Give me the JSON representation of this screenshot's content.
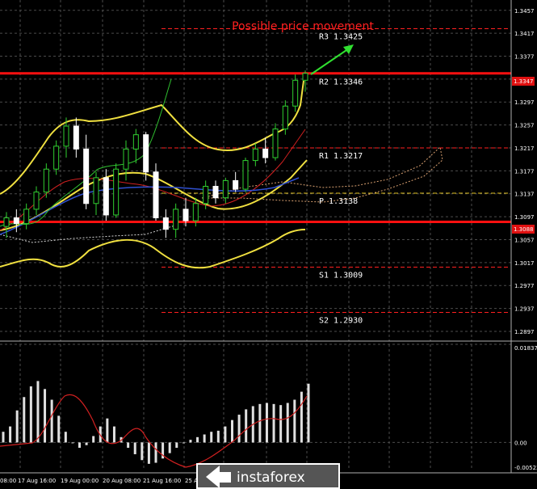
{
  "chart_data": {
    "type": "candlestick",
    "title": "Possible price movement",
    "price_axis": {
      "ylim": [
        1.288,
        1.3475
      ],
      "ticks": [
        "1.3457",
        "1.3417",
        "1.3377",
        "1.3337",
        "1.3297",
        "1.3257",
        "1.3217",
        "1.3177",
        "1.3137",
        "1.3097",
        "1.3057",
        "1.3017",
        "1.2977",
        "1.2937",
        "1.2897"
      ],
      "current_price": "1.3347",
      "marked_price": "1.3088"
    },
    "time_axis": {
      "labels": [
        "08:00",
        "17 Aug 16:00",
        "19 Aug 00:00",
        "20 Aug 08:00",
        "21 Aug 16:00",
        "25 A"
      ]
    },
    "levels": [
      {
        "name": "R3",
        "price": 1.3425,
        "label": "R3 1.3425",
        "color": "#ff2020"
      },
      {
        "name": "R2",
        "price": 1.3346,
        "label": "R2 1.3346",
        "color": "#ff2020"
      },
      {
        "name": "R1",
        "price": 1.3217,
        "label": "R1 1.3217",
        "color": "#ff2020"
      },
      {
        "name": "P",
        "price": 1.3138,
        "label": "P 1.3138",
        "color": "#e0c020"
      },
      {
        "name": "S1",
        "price": 1.3009,
        "label": "S1 1.3009",
        "color": "#ff2020"
      },
      {
        "name": "S2",
        "price": 1.293,
        "label": "S2 1.2930",
        "color": "#ff2020"
      }
    ],
    "support_resistance_lines": [
      1.3347,
      1.3088
    ],
    "candles": [
      [
        1.308,
        1.3105,
        1.306,
        1.3095
      ],
      [
        1.3095,
        1.311,
        1.307,
        1.3085
      ],
      [
        1.3085,
        1.312,
        1.3075,
        1.311
      ],
      [
        1.311,
        1.315,
        1.31,
        1.314
      ],
      [
        1.314,
        1.319,
        1.313,
        1.318
      ],
      [
        1.318,
        1.323,
        1.317,
        1.322
      ],
      [
        1.322,
        1.327,
        1.32,
        1.3255
      ],
      [
        1.3255,
        1.327,
        1.32,
        1.3215
      ],
      [
        1.3215,
        1.324,
        1.311,
        1.312
      ],
      [
        1.312,
        1.3175,
        1.31,
        1.3165
      ],
      [
        1.3165,
        1.318,
        1.309,
        1.31
      ],
      [
        1.31,
        1.319,
        1.3095,
        1.318
      ],
      [
        1.318,
        1.323,
        1.316,
        1.3215
      ],
      [
        1.3215,
        1.325,
        1.319,
        1.324
      ],
      [
        1.324,
        1.3245,
        1.316,
        1.3175
      ],
      [
        1.3175,
        1.319,
        1.309,
        1.3095
      ],
      [
        1.3095,
        1.311,
        1.306,
        1.3075
      ],
      [
        1.3075,
        1.312,
        1.306,
        1.311
      ],
      [
        1.311,
        1.313,
        1.308,
        1.309
      ],
      [
        1.309,
        1.313,
        1.308,
        1.312
      ],
      [
        1.312,
        1.316,
        1.311,
        1.315
      ],
      [
        1.315,
        1.316,
        1.312,
        1.313
      ],
      [
        1.313,
        1.3165,
        1.312,
        1.316
      ],
      [
        1.316,
        1.3175,
        1.314,
        1.3145
      ],
      [
        1.3145,
        1.32,
        1.314,
        1.3195
      ],
      [
        1.3195,
        1.3225,
        1.3185,
        1.3215
      ],
      [
        1.3215,
        1.3235,
        1.319,
        1.32
      ],
      [
        1.32,
        1.326,
        1.3195,
        1.325
      ],
      [
        1.325,
        1.33,
        1.324,
        1.329
      ],
      [
        1.329,
        1.3345,
        1.328,
        1.3335
      ],
      [
        1.3335,
        1.3352,
        1.3315,
        1.3347
      ]
    ],
    "oscillator": {
      "ylim": [
        -0.00523,
        0.01837
      ],
      "ticks": [
        "0.01837",
        "0.00",
        "-0.00523"
      ],
      "histogram": [
        0.002,
        0.003,
        0.006,
        0.0085,
        0.0105,
        0.0115,
        0.01,
        0.008,
        0.005,
        0.002,
        0.0,
        -0.001,
        -0.0005,
        0.0012,
        0.003,
        0.0045,
        0.003,
        0.001,
        -0.001,
        -0.0022,
        -0.0033,
        -0.004,
        -0.0038,
        -0.003,
        -0.002,
        -0.001,
        0.0,
        0.0005,
        0.001,
        0.0015,
        0.002,
        0.0022,
        0.003,
        0.0042,
        0.0052,
        0.0062,
        0.0068,
        0.0072,
        0.0074,
        0.0072,
        0.007,
        0.0074,
        0.008,
        0.0095,
        0.011
      ]
    }
  },
  "branding": {
    "logo_text": "instaforex"
  }
}
